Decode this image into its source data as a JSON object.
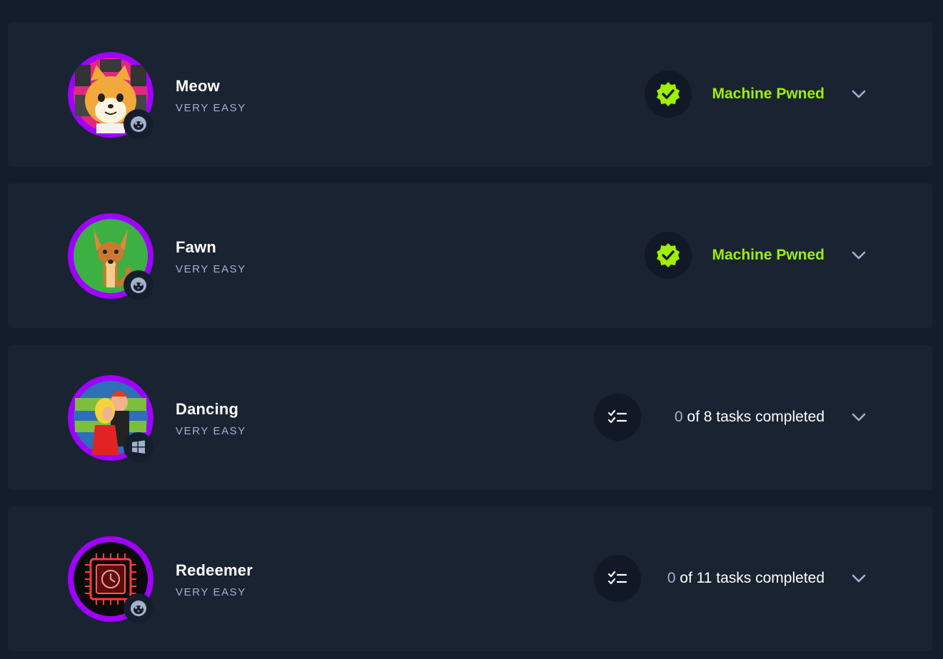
{
  "colors": {
    "background": "#141d2b",
    "card": "#1a2332",
    "accent_green": "#9fef00",
    "ring_purple": "#9f00ff",
    "muted_text": "#a4b1cd"
  },
  "machines": [
    {
      "name": "Meow",
      "difficulty": "VERY EASY",
      "os_icon": "linux-icon",
      "status_icon": "verified-badge-icon",
      "status": "Machine Pwned",
      "avatar_icon": "cat-avatar-icon"
    },
    {
      "name": "Fawn",
      "difficulty": "VERY EASY",
      "os_icon": "linux-icon",
      "status_icon": "verified-badge-icon",
      "status": "Machine Pwned",
      "avatar_icon": "deer-avatar-icon"
    },
    {
      "name": "Dancing",
      "difficulty": "VERY EASY",
      "os_icon": "windows-icon",
      "status_icon": "task-list-icon",
      "tasks_done": "0",
      "tasks_rest": " of 8 tasks completed",
      "avatar_icon": "dancers-avatar-icon"
    },
    {
      "name": "Redeemer",
      "difficulty": "VERY EASY",
      "os_icon": "linux-icon",
      "status_icon": "task-list-icon",
      "tasks_done": "0",
      "tasks_rest": " of 11 tasks completed",
      "avatar_icon": "chip-avatar-icon"
    }
  ]
}
